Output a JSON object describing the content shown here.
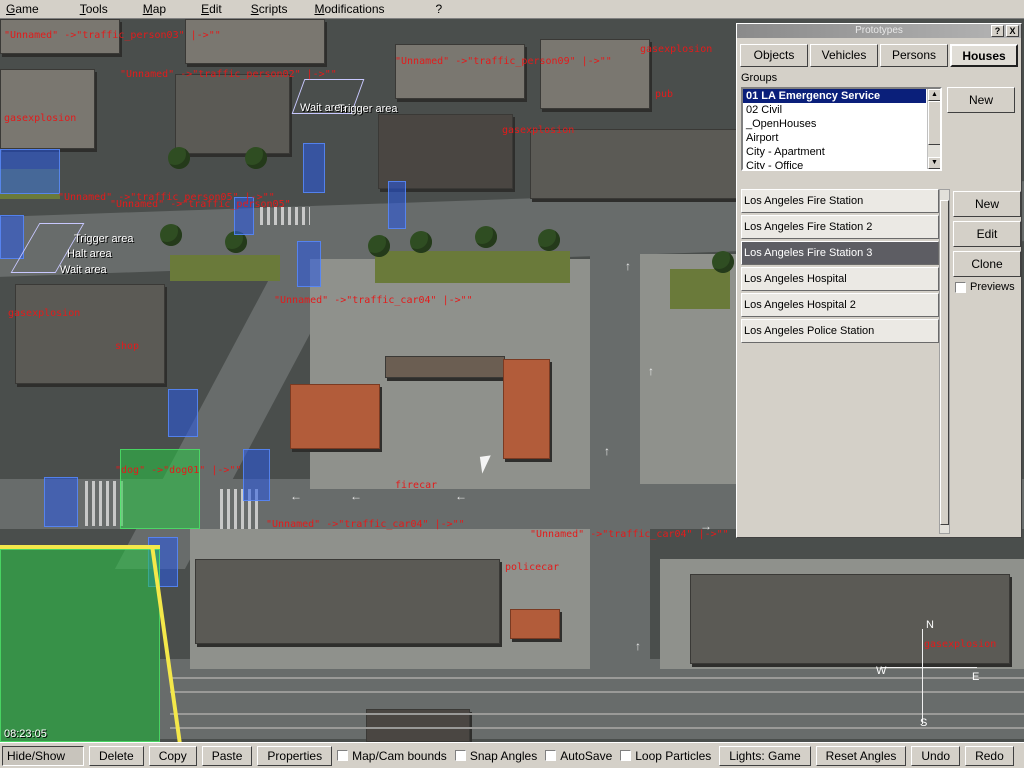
{
  "menubar": [
    "Game",
    "Tools",
    "Map",
    "Edit",
    "Scripts",
    "Modifications",
    "?"
  ],
  "viewport": {
    "clock": "08:23:05",
    "compass": {
      "n": "N",
      "s": "S",
      "e": "E",
      "w": "W"
    },
    "white_labels": [
      "Trigger area",
      "Halt area",
      "Wait area",
      "Wait area",
      "Trigger area"
    ],
    "script_labels": [
      "\"Unnamed\" ->\"traffic_person03\" |->\"\"",
      "\"Unnamed\" ->\"traffic_person05\" |->\"\"",
      "\"Unnamed\" ->\"traffic_person05\"",
      "\"Unnamed\" ->\"traffic_person02\" |->\"\"",
      "\"Unnamed\" ->\"traffic_person09\" |->\"\"",
      "\"Unnamed\" ->\"traffic_car04\" |->\"\"",
      "\"Unnamed\" ->\"traffic_car04\" |->\"\"",
      "\"Unnamed\" ->\"traffic_car04\" |->\"\"",
      "\"dog\" ->\"dog01\" |->\"\"",
      "gasexplosion",
      "gasexplosion",
      "gasexplosion",
      "gasexplosion",
      "gasexplosion",
      "shop",
      "pub",
      "firecar",
      "policecar"
    ]
  },
  "prototypes": {
    "title": "Prototypes",
    "titlebar_buttons": [
      "?",
      "X"
    ],
    "tabs": [
      "Objects",
      "Vehicles",
      "Persons",
      "Houses"
    ],
    "active_tab": "Houses",
    "groups_label": "Groups",
    "groups": [
      "01 LA Emergency Service",
      "02 Civil",
      "_OpenHouses",
      "Airport",
      "City - Apartment",
      "City - Office"
    ],
    "selected_group": "01 LA Emergency Service",
    "groups_new_label": "New",
    "houses": [
      "Los Angeles Fire Station",
      "Los Angeles Fire Station 2",
      "Los Angeles Fire Station 3",
      "Los Angeles Hospital",
      "Los Angeles Hospital 2",
      "Los Angeles Police Station"
    ],
    "selected_house": "Los Angeles Fire Station 3",
    "buttons": {
      "new": "New",
      "edit": "Edit",
      "clone": "Clone"
    },
    "previews_label": "Previews",
    "previews_checked": false
  },
  "toolbar": {
    "hide_show": "Hide/Show",
    "delete": "Delete",
    "copy": "Copy",
    "paste": "Paste",
    "properties": "Properties",
    "map_cam_bounds": "Map/Cam bounds",
    "snap_angles": "Snap Angles",
    "autosave": "AutoSave",
    "loop_particles": "Loop Particles",
    "lights": "Lights: Game",
    "reset_angles": "Reset Angles",
    "undo": "Undo",
    "redo": "Redo"
  }
}
